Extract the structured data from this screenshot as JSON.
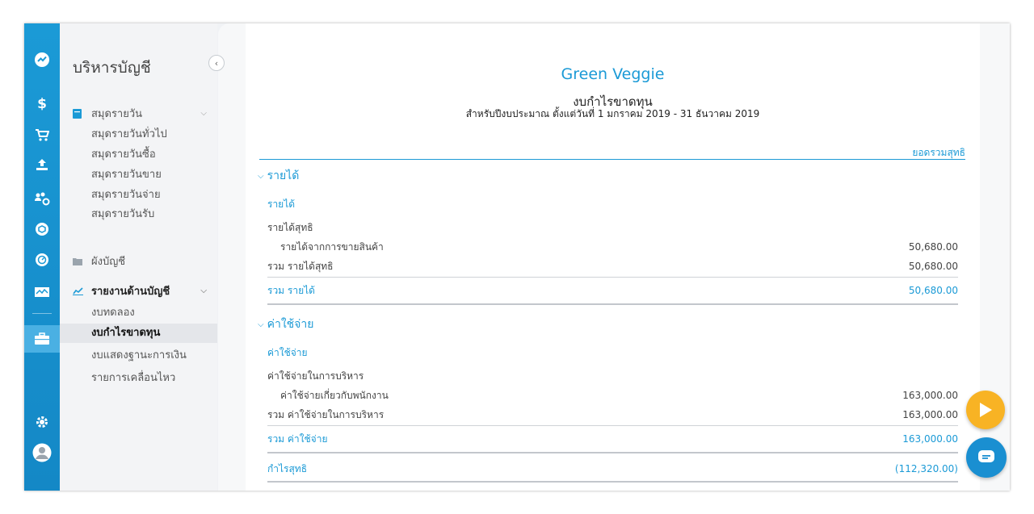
{
  "colors": {
    "primary": "#1b9ad6",
    "accent": "#f8b324"
  },
  "rail": {
    "icons": [
      "trend-icon",
      "dollar-icon",
      "cart-icon",
      "inbox-upload-icon",
      "people-gear-icon",
      "box-icon",
      "gauge-icon",
      "monitor-chart-icon",
      "briefcase-icon",
      "gear-icon",
      "user-icon"
    ],
    "active": "briefcase-icon"
  },
  "sidebar": {
    "title": "บริหารบัญชี",
    "sections": [
      {
        "label": "สมุดรายวัน",
        "icon": "book-icon",
        "items": [
          "สมุดรายวันทั่วไป",
          "สมุดรายวันซื้อ",
          "สมุดรายวันขาย",
          "สมุดรายวันจ่าย",
          "สมุดรายวันรับ"
        ]
      },
      {
        "label": "ผังบัญชี",
        "icon": "folder-icon"
      },
      {
        "label": "รายงานด้านบัญชี",
        "icon": "chart-line-icon",
        "items": [
          "งบทดลอง",
          "งบกำไรขาดทุน",
          "งบแสดงฐานะการเงิน",
          "รายการเคลื่อนไหว"
        ],
        "active_item": "งบกำไรขาดทุน"
      }
    ]
  },
  "report": {
    "company": "Green Veggie",
    "title": "งบกำไรขาดทุน",
    "subtitle": "สำหรับปีงบประมาณ ตั้งแต่วันที่ 1 มกราคม 2019 - 31 ธันวาคม 2019",
    "column_header": "ยอดรวมสุทธิ",
    "revenue": {
      "group": "รายได้",
      "category": "รายได้",
      "subgroup": "รายได้สุทธิ",
      "line_label": "รายได้จากการขายสินค้า",
      "line_value": "50,680.00",
      "subtotal_label": "รวม รายได้สุทธิ",
      "subtotal_value": "50,680.00",
      "total_label": "รวม รายได้",
      "total_value": "50,680.00"
    },
    "expense": {
      "group": "ค่าใช้จ่าย",
      "category": "ค่าใช้จ่าย",
      "subgroup": "ค่าใช้จ่ายในการบริหาร",
      "line_label": "ค่าใช้จ่ายเกี่ยวกับพนักงาน",
      "line_value": "163,000.00",
      "subtotal_label": "รวม ค่าใช้จ่ายในการบริหาร",
      "subtotal_value": "163,000.00",
      "total_label": "รวม ค่าใช้จ่าย",
      "total_value": "163,000.00"
    },
    "net_label": "กำไรสุทธิ",
    "net_value": "(112,320.00)"
  }
}
